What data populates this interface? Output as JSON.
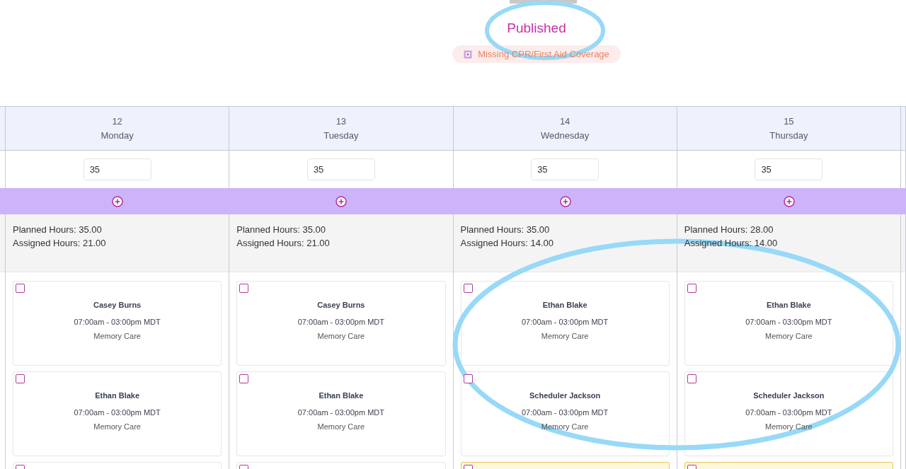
{
  "status": "Published",
  "alert": "Missing CPR/First Aid Coverage",
  "days": [
    {
      "date": "12",
      "day": "Monday",
      "target": "35",
      "planned": "Planned Hours: 35.00",
      "assigned": "Assigned Hours: 21.00",
      "shifts": [
        {
          "name": "Casey Burns",
          "time": "07:00am - 03:00pm MDT",
          "unit": "Memory Care",
          "checked": false,
          "highlighted": false
        },
        {
          "name": "Ethan Blake",
          "time": "07:00am - 03:00pm MDT",
          "unit": "Memory Care",
          "checked": false,
          "highlighted": false
        },
        {
          "checked": false,
          "highlighted": false
        }
      ]
    },
    {
      "date": "13",
      "day": "Tuesday",
      "target": "35",
      "planned": "Planned Hours: 35.00",
      "assigned": "Assigned Hours: 21.00",
      "shifts": [
        {
          "name": "Casey Burns",
          "time": "07:00am - 03:00pm MDT",
          "unit": "Memory Care",
          "checked": false,
          "highlighted": false
        },
        {
          "name": "Ethan Blake",
          "time": "07:00am - 03:00pm MDT",
          "unit": "Memory Care",
          "checked": false,
          "highlighted": false
        },
        {
          "checked": false,
          "highlighted": false
        }
      ]
    },
    {
      "date": "14",
      "day": "Wednesday",
      "target": "35",
      "planned": "Planned Hours: 35.00",
      "assigned": "Assigned Hours: 14.00",
      "shifts": [
        {
          "name": "Ethan Blake",
          "time": "07:00am - 03:00pm MDT",
          "unit": "Memory Care",
          "checked": false,
          "highlighted": false
        },
        {
          "name": "Scheduler Jackson",
          "time": "07:00am - 03:00pm MDT",
          "unit": "Memory Care",
          "checked": false,
          "highlighted": false
        },
        {
          "checked": false,
          "highlighted": true
        }
      ]
    },
    {
      "date": "15",
      "day": "Thursday",
      "target": "35",
      "planned": "Planned Hours: 28.00",
      "assigned": "Assigned Hours: 14.00",
      "shifts": [
        {
          "name": "Ethan Blake",
          "time": "07:00am - 03:00pm MDT",
          "unit": "Memory Care",
          "checked": false,
          "highlighted": false
        },
        {
          "name": "Scheduler Jackson",
          "time": "07:00am - 03:00pm MDT",
          "unit": "Memory Care",
          "checked": false,
          "highlighted": false
        },
        {
          "checked": false,
          "highlighted": true
        }
      ]
    }
  ]
}
